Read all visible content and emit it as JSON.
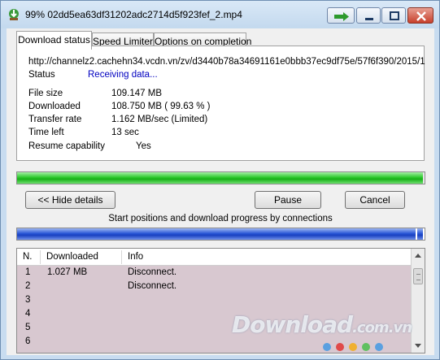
{
  "window": {
    "title": "99% 02dd5ea63df31202adc2714d5f923fef_2.mp4"
  },
  "tabs": [
    {
      "label": "Download status",
      "active": true
    },
    {
      "label": "Speed Limiter",
      "active": false
    },
    {
      "label": "Options on completion",
      "active": false
    }
  ],
  "details": {
    "url": "http://channelz2.cachehn34.vcdn.vn/zv/d3440b78a34691161e0bbb37ec9df75e/57f6f390/2015/1",
    "status_label": "Status",
    "status_value": "Receiving data...",
    "file_size_label": "File size",
    "file_size_value": "109.147  MB",
    "downloaded_label": "Downloaded",
    "downloaded_value": "108.750  MB  ( 99.63 % )",
    "transfer_rate_label": "Transfer rate",
    "transfer_rate_value": "1.162  MB/sec  (Limited)",
    "time_left_label": "Time left",
    "time_left_value": "13 sec",
    "resume_label": "Resume capability",
    "resume_value": "Yes"
  },
  "progress": {
    "percent": 99.63,
    "color": "#2dc82d"
  },
  "buttons": {
    "hide_details": "<< Hide details",
    "pause": "Pause",
    "cancel": "Cancel"
  },
  "connections": {
    "title": "Start positions and download progress by connections",
    "progress_percent": 99.6,
    "color": "#2a57d6",
    "columns": [
      "N.",
      "Downloaded",
      "Info"
    ],
    "rows": [
      {
        "n": "1",
        "downloaded": "1.027  MB",
        "info": "Disconnect."
      },
      {
        "n": "2",
        "downloaded": "",
        "info": "Disconnect."
      },
      {
        "n": "3",
        "downloaded": "",
        "info": ""
      },
      {
        "n": "4",
        "downloaded": "",
        "info": ""
      },
      {
        "n": "5",
        "downloaded": "",
        "info": ""
      },
      {
        "n": "6",
        "downloaded": "",
        "info": ""
      }
    ]
  },
  "watermark": {
    "text": "Download",
    "suffix": ".com.vn"
  }
}
